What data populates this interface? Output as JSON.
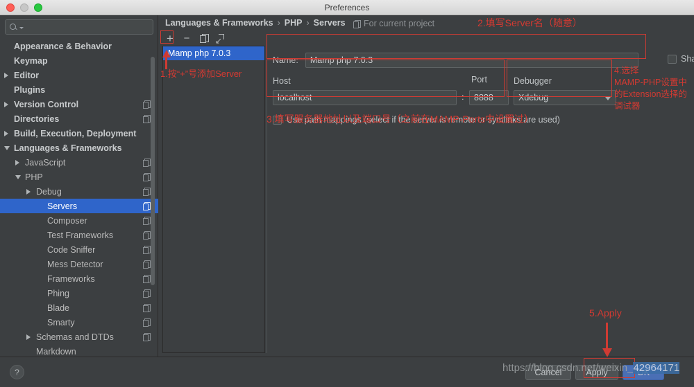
{
  "window": {
    "title": "Preferences"
  },
  "search": {
    "placeholder": "",
    "icon": "search-icon"
  },
  "sidebar": {
    "items": [
      {
        "label": "Appearance & Behavior",
        "indent": 0,
        "arrow": "none",
        "bold": true,
        "copy": false,
        "selected": false
      },
      {
        "label": "Keymap",
        "indent": 0,
        "arrow": "none",
        "bold": true,
        "copy": false,
        "selected": false
      },
      {
        "label": "Editor",
        "indent": 0,
        "arrow": "closed",
        "bold": true,
        "copy": false,
        "selected": false
      },
      {
        "label": "Plugins",
        "indent": 0,
        "arrow": "none",
        "bold": true,
        "copy": false,
        "selected": false
      },
      {
        "label": "Version Control",
        "indent": 0,
        "arrow": "closed",
        "bold": true,
        "copy": true,
        "selected": false
      },
      {
        "label": "Directories",
        "indent": 0,
        "arrow": "none",
        "bold": true,
        "copy": true,
        "selected": false
      },
      {
        "label": "Build, Execution, Deployment",
        "indent": 0,
        "arrow": "closed",
        "bold": true,
        "copy": false,
        "selected": false
      },
      {
        "label": "Languages & Frameworks",
        "indent": 0,
        "arrow": "open",
        "bold": true,
        "copy": false,
        "selected": false
      },
      {
        "label": "JavaScript",
        "indent": 1,
        "arrow": "closed",
        "bold": false,
        "copy": true,
        "selected": false
      },
      {
        "label": "PHP",
        "indent": 1,
        "arrow": "open",
        "bold": false,
        "copy": true,
        "selected": false
      },
      {
        "label": "Debug",
        "indent": 2,
        "arrow": "closed",
        "bold": false,
        "copy": true,
        "selected": false
      },
      {
        "label": "Servers",
        "indent": 3,
        "arrow": "none",
        "bold": false,
        "copy": true,
        "selected": true
      },
      {
        "label": "Composer",
        "indent": 3,
        "arrow": "none",
        "bold": false,
        "copy": true,
        "selected": false
      },
      {
        "label": "Test Frameworks",
        "indent": 3,
        "arrow": "none",
        "bold": false,
        "copy": true,
        "selected": false
      },
      {
        "label": "Code Sniffer",
        "indent": 3,
        "arrow": "none",
        "bold": false,
        "copy": true,
        "selected": false
      },
      {
        "label": "Mess Detector",
        "indent": 3,
        "arrow": "none",
        "bold": false,
        "copy": true,
        "selected": false
      },
      {
        "label": "Frameworks",
        "indent": 3,
        "arrow": "none",
        "bold": false,
        "copy": true,
        "selected": false
      },
      {
        "label": "Phing",
        "indent": 3,
        "arrow": "none",
        "bold": false,
        "copy": true,
        "selected": false
      },
      {
        "label": "Blade",
        "indent": 3,
        "arrow": "none",
        "bold": false,
        "copy": true,
        "selected": false
      },
      {
        "label": "Smarty",
        "indent": 3,
        "arrow": "none",
        "bold": false,
        "copy": true,
        "selected": false
      },
      {
        "label": "Schemas and DTDs",
        "indent": 2,
        "arrow": "closed",
        "bold": false,
        "copy": true,
        "selected": false
      },
      {
        "label": "Markdown",
        "indent": 2,
        "arrow": "none",
        "bold": false,
        "copy": false,
        "selected": false
      }
    ]
  },
  "breadcrumb": {
    "parts": [
      "Languages & Frameworks",
      "PHP",
      "Servers"
    ],
    "separator": "›",
    "for_project": "For current project"
  },
  "toolbar": {
    "add_label": "+",
    "remove_label": "−",
    "copy_label": "copy-icon",
    "import_label": "import-icon"
  },
  "server_list": {
    "items": [
      {
        "label": "Mamp php 7.0.3",
        "selected": true
      }
    ]
  },
  "form": {
    "name_label": "Name:",
    "name_value": "Mamp php 7.0.3",
    "shared_label": "Shared",
    "shared_checked": false,
    "host_label": "Host",
    "host_value": "localhost",
    "port_label": "Port",
    "port_value": "8888",
    "colon": ":",
    "debugger_label": "Debugger",
    "debugger_value": "Xdebug",
    "path_mappings_label": "Use path mappings (select if the server is remote or symlinks are used)",
    "path_mappings_checked": false
  },
  "bottom": {
    "help_label": "?",
    "cancel_label": "Cancel",
    "apply_label": "Apply",
    "ok_label": "OK"
  },
  "annotations": {
    "step1": "1.按“+”号添加Server",
    "step2": "2.填写Server名（随意）",
    "step3": "3.填写服务器地址以及端口号（之前在MAMP-Ports中设置过）",
    "step4": "4.选择\nMAMP-PHP设置中\n的Extension选择的\n调试器",
    "step5": "5.Apply"
  },
  "watermark": {
    "prefix": "https://blog.csdn.net/weixin_",
    "highlight": "42964171"
  },
  "colors": {
    "annotation": "#d43a32",
    "selection": "#2f65ca",
    "panel_bg": "#3c3f41"
  }
}
